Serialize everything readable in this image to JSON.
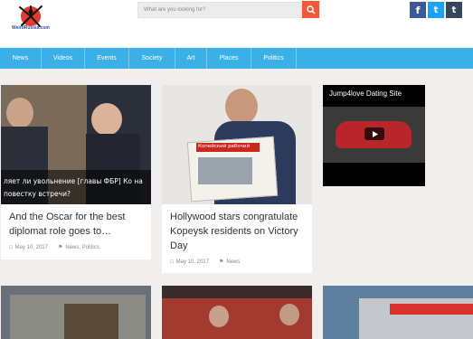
{
  "header": {
    "logo_text": "WeirdRussia.com",
    "search_placeholder": "What are you looking for?",
    "social": {
      "facebook": "f",
      "twitter": "t",
      "tumblr": "t"
    }
  },
  "nav": [
    "News",
    "Videos",
    "Events",
    "Society",
    "Art",
    "Places",
    "Politics"
  ],
  "articles": [
    {
      "title": "And the Oscar for the best diplomat role goes to…",
      "date": "May 10, 2017",
      "tags": "News, Politics",
      "image_caption": "ляет ли увольнение [главы ФБР] Ко на повестку встречи?"
    },
    {
      "title": "Hollywood stars congratulate Kopeysk residents on Victory Day",
      "date": "May 10, 2017",
      "tags": "News",
      "newspaper_text": "Копейский рабочий"
    }
  ],
  "ad": {
    "title": "Jump4love Dating Site"
  },
  "colors": {
    "nav": "#3bb0e6",
    "search_btn": "#f05a3c",
    "facebook": "#3b5998",
    "twitter": "#1da1f2",
    "tumblr": "#35465c"
  }
}
